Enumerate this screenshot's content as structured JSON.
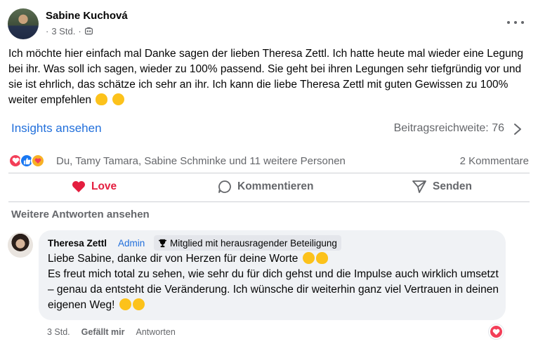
{
  "post": {
    "author": "Sabine Kuchová",
    "time": "3 Std.",
    "separator": "·",
    "text": "Ich möchte hier einfach mal Danke sagen der lieben Theresa Zettl. Ich hatte heute mal wieder eine Legung bei ihr. Was soll ich sagen, wieder zu 100% passend. Sie geht bei ihren Legungen sehr tiefgründig vor und sie ist ehrlich, das schätze ich sehr an ihr. Ich kann die liebe Theresa Zettl mit guten Gewissen zu 100% weiter empfehlen",
    "insights_link": "Insights ansehen",
    "reach": "Beitragsreichweite: 76"
  },
  "reactions": {
    "names": "Du, Tamy Tamara, Sabine Schminke und 11 weitere Personen",
    "comments_count": "2 Kommentare",
    "icons": [
      "love-icon",
      "like-icon",
      "care-icon"
    ]
  },
  "actions": {
    "love": "Love",
    "comment": "Kommentieren",
    "share": "Senden"
  },
  "more_answers": "Weitere Antworten ansehen",
  "comment": {
    "author": "Theresa Zettl",
    "role": "Admin",
    "badge": "Mitglied mit herausragender Beteiligung",
    "line1": "Liebe Sabine, danke dir von Herzen für deine Worte",
    "line2": "Es freut mich total zu sehen, wie sehr du für dich gehst und die Impulse auch wirklich umsetzt – genau da entsteht die Veränderung. Ich wünsche dir weiterhin ganz viel Vertrauen in deinen eigenen Weg!",
    "time": "3 Std.",
    "liked": "Gefällt mir",
    "reply": "Antworten"
  },
  "colors": {
    "accent": "#216fdb",
    "love": "#e41e3f",
    "muted": "#65676b"
  }
}
